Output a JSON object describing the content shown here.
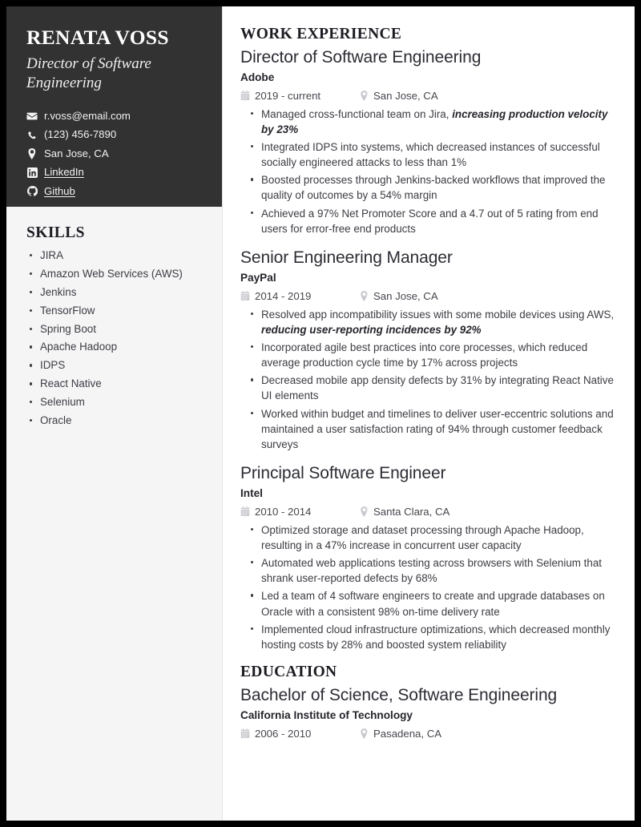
{
  "theme": {
    "page_border": "#000000",
    "header_bg": "#323232",
    "sidebar_bg": "#f5f5f6",
    "text_dark": "#1c1c23",
    "text_body": "#3c3c43",
    "icon_muted": "#c9c9cf"
  },
  "profile": {
    "name": "RENATA VOSS",
    "title": "Director of Software Engineering",
    "contacts": [
      {
        "icon": "envelope-icon",
        "label": "r.voss@email.com",
        "link": false
      },
      {
        "icon": "phone-icon",
        "label": "(123) 456-7890",
        "link": false
      },
      {
        "icon": "map-pin-icon",
        "label": "San Jose, CA",
        "link": false
      },
      {
        "icon": "linkedin-icon",
        "label": "LinkedIn",
        "link": true
      },
      {
        "icon": "github-icon",
        "label": "Github",
        "link": true
      }
    ]
  },
  "skills": {
    "heading": "SKILLS",
    "items": [
      "JIRA",
      "Amazon Web Services (AWS)",
      "Jenkins",
      "TensorFlow",
      "Spring Boot",
      "Apache Hadoop",
      "IDPS",
      "React Native",
      "Selenium",
      "Oracle"
    ]
  },
  "work": {
    "heading": "WORK EXPERIENCE",
    "entries": [
      {
        "title": "Director of Software Engineering",
        "org": "Adobe",
        "date": "2019 - current",
        "location": "San Jose, CA",
        "bullets": [
          "Managed cross-functional team on Jira, <b>increasing production velocity by 23%</b>",
          "Integrated IDPS into systems, which decreased instances of successful socially engineered attacks to less than 1%",
          "Boosted processes through Jenkins-backed workflows that improved the quality of outcomes by a 54% margin",
          "Achieved a 97% Net Promoter Score and a 4.7 out of 5 rating from end users for error-free end products"
        ]
      },
      {
        "title": "Senior Engineering Manager",
        "org": "PayPal",
        "date": "2014 - 2019",
        "location": "San Jose, CA",
        "bullets": [
          "Resolved app incompatibility issues with some mobile devices using AWS, <b>reducing user-reporting incidences by 92%</b>",
          "Incorporated agile best practices into core processes, which reduced average production cycle time by 17% across projects",
          "Decreased mobile app density defects by 31% by integrating React Native UI elements",
          "Worked within budget and timelines to deliver user-eccentric solutions and maintained a user satisfaction rating of 94% through customer feedback surveys"
        ]
      },
      {
        "title": "Principal Software Engineer",
        "org": "Intel",
        "date": "2010 - 2014",
        "location": "Santa Clara, CA",
        "bullets": [
          "Optimized storage and dataset processing through Apache Hadoop, resulting in a 47% increase in concurrent user capacity",
          "Automated web applications testing across browsers with Selenium that shrank user-reported defects by 68%",
          "Led a team of 4 software engineers to create and upgrade databases on Oracle with a consistent 98% on-time delivery rate",
          "Implemented cloud infrastructure optimizations, which decreased monthly hosting costs by 28% and boosted system reliability"
        ]
      }
    ]
  },
  "education": {
    "heading": "EDUCATION",
    "entries": [
      {
        "title": "Bachelor of Science, Software Engineering",
        "org": "California Institute of Technology",
        "date": "2006 - 2010",
        "location": "Pasadena, CA"
      }
    ]
  }
}
